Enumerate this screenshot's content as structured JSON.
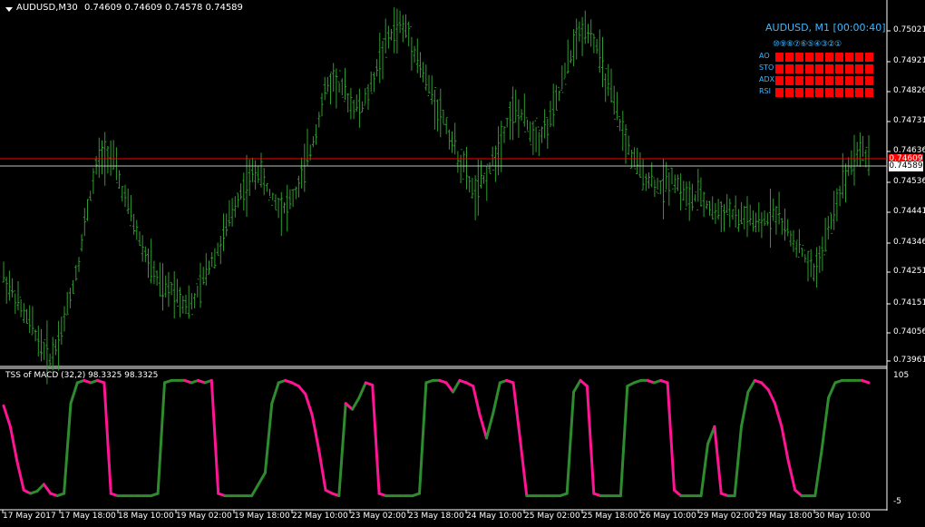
{
  "header": {
    "symbol": "AUDUSD,M30",
    "ohlc": "0.74609 0.74609 0.74578 0.74589"
  },
  "price_axis": {
    "ticks": [
      "0.75021",
      "0.74921",
      "0.74826",
      "0.74731",
      "0.74636",
      "0.74536",
      "0.74441",
      "0.74346",
      "0.74251",
      "0.74151",
      "0.74056",
      "0.73961"
    ],
    "bid_price": "0.74589",
    "ask_price": "0.74609"
  },
  "time_axis": {
    "ticks": [
      "17 May 2017",
      "17 May 18:00",
      "18 May 10:00",
      "19 May 02:00",
      "19 May 18:00",
      "22 May 10:00",
      "23 May 02:00",
      "23 May 18:00",
      "24 May 10:00",
      "25 May 02:00",
      "25 May 18:00",
      "26 May 10:00",
      "29 May 02:00",
      "29 May 18:00",
      "30 May 10:00"
    ]
  },
  "dashboard": {
    "title": "AUDUSD, M1 [00:00:40]",
    "timeframe_numbers": "⑩⑨⑧⑦⑥⑤④③②①",
    "rows": [
      "AO",
      "STO",
      "ADX",
      "RSI"
    ],
    "cell_color": "#ff0000"
  },
  "indicator": {
    "label": "TSS of MACD (32,2) 98.3325 98.3325",
    "axis_top": "105",
    "axis_bottom": "-5"
  },
  "colors": {
    "candle": "#2e9b2e",
    "macd_up": "#2e8b2e",
    "macd_down": "#ff1493",
    "bid_line": "#c0c0c0",
    "ask_line": "#ff0000",
    "accent_text": "#3fb7ff"
  },
  "chart_data": [
    {
      "type": "line",
      "title": "",
      "series": [
        {
          "name": "AUDUSD,M30",
          "values": [
            0.7423,
            0.7418,
            0.7412,
            0.7408,
            0.7402,
            0.7398,
            0.7405,
            0.7416,
            0.7428,
            0.7445,
            0.7458,
            0.7462,
            0.7455,
            0.7446,
            0.7438,
            0.743,
            0.7424,
            0.7418,
            0.742,
            0.7416,
            0.7414,
            0.742,
            0.7428,
            0.7432,
            0.744,
            0.7448,
            0.7452,
            0.7456,
            0.745,
            0.7446,
            0.7444,
            0.7448,
            0.7456,
            0.7465,
            0.7478,
            0.7484,
            0.748,
            0.7476,
            0.7474,
            0.748,
            0.749,
            0.7496,
            0.75,
            0.7498,
            0.749,
            0.7482,
            0.7476,
            0.747,
            0.7462,
            0.7456,
            0.7448,
            0.7452,
            0.7458,
            0.7466,
            0.7474,
            0.7472,
            0.7468,
            0.7466,
            0.747,
            0.7478,
            0.7488,
            0.7496,
            0.75,
            0.7494,
            0.7484,
            0.7474,
            0.7466,
            0.7458,
            0.7454,
            0.7452,
            0.745,
            0.7454,
            0.745,
            0.7446,
            0.7448,
            0.7444,
            0.7442,
            0.7444,
            0.744,
            0.7442,
            0.7438,
            0.744,
            0.7444,
            0.7438,
            0.7434,
            0.743,
            0.7424,
            0.743,
            0.744,
            0.745,
            0.7458,
            0.7462,
            0.746
          ]
        }
      ],
      "ylim": [
        0.73961,
        0.7507
      ]
    },
    {
      "type": "line",
      "title": "TSS of MACD (32,2)",
      "series": [
        {
          "name": "TSS of MACD",
          "values": [
            78,
            60,
            30,
            5,
            2,
            4,
            10,
            2,
            0,
            2,
            80,
            98,
            100,
            98,
            100,
            98,
            2,
            0,
            0,
            0,
            0,
            0,
            0,
            2,
            98,
            100,
            100,
            100,
            98,
            100,
            98,
            100,
            2,
            0,
            0,
            0,
            0,
            0,
            10,
            20,
            80,
            98,
            100,
            98,
            95,
            88,
            70,
            40,
            5,
            2,
            0,
            80,
            75,
            85,
            98,
            96,
            2,
            0,
            0,
            0,
            0,
            0,
            2,
            98,
            100,
            100,
            98,
            90,
            100,
            98,
            95,
            70,
            50,
            72,
            98,
            100,
            98,
            50,
            0,
            0,
            0,
            0,
            0,
            0,
            2,
            90,
            100,
            95,
            2,
            0,
            0,
            0,
            0,
            95,
            98,
            100,
            100,
            98,
            100,
            98,
            5,
            0,
            0,
            0,
            0,
            45,
            60,
            2,
            0,
            0,
            60,
            90,
            100,
            98,
            92,
            80,
            60,
            30,
            5,
            0,
            0,
            0,
            40,
            85,
            98,
            100,
            100,
            100,
            100,
            98
          ]
        }
      ],
      "ylim": [
        -5,
        105
      ]
    }
  ]
}
